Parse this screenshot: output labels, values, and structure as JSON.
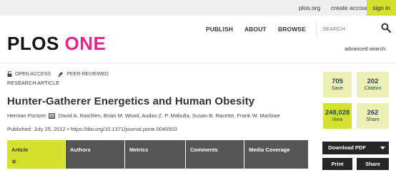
{
  "topbar": {
    "plos_org": "plos.org",
    "create_account": "create account",
    "sign_in": "sign in"
  },
  "header": {
    "nav": [
      "PUBLISH",
      "ABOUT",
      "BROWSE"
    ],
    "search_placeholder": "SEARCH",
    "search_icon": "search-icon",
    "logo_part1": "PLOS",
    "logo_part2": "ONE",
    "advanced_search": "advanced search"
  },
  "article": {
    "open_access": "OPEN ACCESS",
    "peer_reviewed": "PEER-REVIEWED",
    "type": "RESEARCH ARTICLE",
    "title": "Hunter-Gatherer Energetics and Human Obesity",
    "first_author": "Herman Pontzer",
    "other_authors": "David A. Raichlen, Brian M. Wood, Audax Z. P. Mabulla, Susan B. Racette, Frank W. Marlowe",
    "published": "Published: July 25, 2012",
    "doi": "https://doi.org/10.1371/journal.pone.0040503"
  },
  "metrics": {
    "save": {
      "value": "705",
      "label": "Save"
    },
    "citation": {
      "value": "202",
      "label": "Citation"
    },
    "view": {
      "value": "248,028",
      "label": "View"
    },
    "share": {
      "value": "262",
      "label": "Share"
    }
  },
  "tabs": [
    "Article",
    "Authors",
    "Metrics",
    "Comments",
    "Media Coverage"
  ],
  "actions": {
    "download_pdf": "Download PDF",
    "print": "Print",
    "share": "Share"
  },
  "colors": {
    "accent": "#d5e12f",
    "accent_light": "#eef0b3",
    "logo_pink": "#e8228a",
    "tab_dark": "#555555",
    "button_dark": "#262626"
  }
}
